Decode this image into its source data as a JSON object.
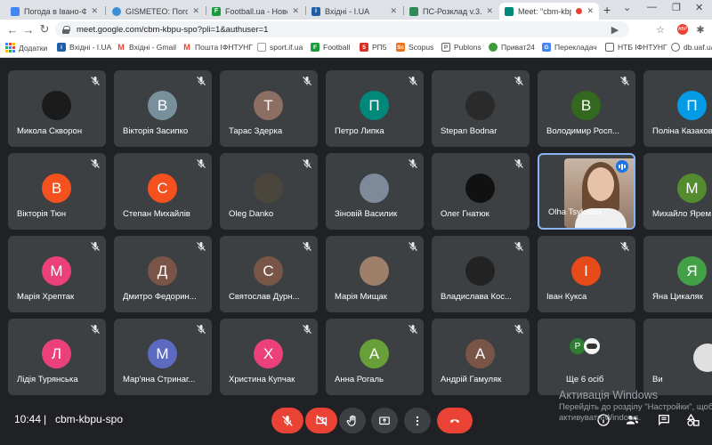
{
  "browser": {
    "tabs": [
      {
        "title": "Погода в Івано-Франк",
        "favicon": "weather",
        "color": "#4285f4"
      },
      {
        "title": "GISMETEO: Погода в",
        "favicon": "gismeteo",
        "color": "#3b8fd6"
      },
      {
        "title": "Football.ua - Новост",
        "favicon": "football",
        "color": "#1a9c3e"
      },
      {
        "title": "Вхідні - I.UA",
        "favicon": "iua",
        "color": "#1f5fa8"
      },
      {
        "title": "ПС-Розклад v.3.8.2",
        "favicon": "schedule",
        "color": "#2e8b57"
      },
      {
        "title": "Meet: \"cbm-kbpu",
        "favicon": "meet",
        "color": "#00897b"
      }
    ],
    "url": "meet.google.com/cbm-kbpu-spo?pli=1&authuser=1",
    "bookmarks": [
      {
        "label": "Додатки",
        "icon": "apps",
        "color": "#5f6368"
      },
      {
        "label": "Вхідні - I.UA",
        "icon": "iua",
        "color": "#1f5fa8"
      },
      {
        "label": "Вхідні - Gmail",
        "icon": "gmail",
        "color": "#ea4335"
      },
      {
        "label": "Пошта ІФНТУНГ",
        "icon": "gmail",
        "color": "#ea4335"
      },
      {
        "label": "sport.if.ua",
        "icon": "page",
        "color": "#9aa0a6"
      },
      {
        "label": "Football",
        "icon": "football",
        "color": "#1a9c3e"
      },
      {
        "label": "РП5",
        "icon": "rp5",
        "color": "#d93025"
      },
      {
        "label": "Scopus",
        "icon": "scopus",
        "color": "#e9711c"
      },
      {
        "label": "Publons",
        "icon": "publons",
        "color": "#5f6368"
      },
      {
        "label": "Приват24",
        "icon": "privat",
        "color": "#3c9b3c"
      },
      {
        "label": "Перекладач",
        "icon": "translate",
        "color": "#4285f4"
      },
      {
        "label": "НТБ ІФНТУНГ",
        "icon": "library",
        "color": "#5f6368"
      },
      {
        "label": "db.uaf.ua",
        "icon": "globe",
        "color": "#5f6368"
      }
    ]
  },
  "participants": [
    {
      "name": "Микола Скворон",
      "initial": "",
      "color": "#1b1b1b",
      "photo": true
    },
    {
      "name": "Вікторія Засипко",
      "initial": "В",
      "color": "#78909c"
    },
    {
      "name": "Тарас Здерка",
      "initial": "Т",
      "color": "#8d6e63"
    },
    {
      "name": "Петро Липка",
      "initial": "П",
      "color": "#00897b"
    },
    {
      "name": "Stepan Bodnar",
      "initial": "",
      "color": "#2a2a2a",
      "photo": true
    },
    {
      "name": "Володимир Росп...",
      "initial": "В",
      "color": "#33691e"
    },
    {
      "name": "Поліна Казакова",
      "initial": "П",
      "color": "#039be5"
    },
    {
      "name": "Вікторія Тюн",
      "initial": "В",
      "color": "#f4511e"
    },
    {
      "name": "Степан Михайлів",
      "initial": "С",
      "color": "#f4511e"
    },
    {
      "name": "Oleg Danko",
      "initial": "",
      "color": "#4a463e",
      "photo": true
    },
    {
      "name": "Зіновій Василик",
      "initial": "",
      "color": "#7c8a99",
      "photo": true
    },
    {
      "name": "Олег Гнатюк",
      "initial": "",
      "color": "#111111",
      "photo": true
    },
    {
      "name": "Olha Tsykaliak",
      "initial": "",
      "color": "#b39a87",
      "video": true
    },
    {
      "name": "Михайло Ярем",
      "initial": "М",
      "color": "#558b2f"
    },
    {
      "name": "Марія Хрептак",
      "initial": "М",
      "color": "#ec407a"
    },
    {
      "name": "Дмитро Федорин...",
      "initial": "Д",
      "color": "#795548"
    },
    {
      "name": "Святослав Дурн...",
      "initial": "С",
      "color": "#795548"
    },
    {
      "name": "Марія Мищак",
      "initial": "",
      "color": "#9e7f6a",
      "photo": true
    },
    {
      "name": "Владислава Кос...",
      "initial": "",
      "color": "#222222",
      "photo": true
    },
    {
      "name": "Іван Кукса",
      "initial": "І",
      "color": "#e64a19"
    },
    {
      "name": "Яна Цикаляк",
      "initial": "Я",
      "color": "#43a047"
    },
    {
      "name": "Лідія Турянська",
      "initial": "Л",
      "color": "#ec407a"
    },
    {
      "name": "Мар'яна Стринаг...",
      "initial": "М",
      "color": "#5c6bc0"
    },
    {
      "name": "Христина Купчак",
      "initial": "Х",
      "color": "#ec407a"
    },
    {
      "name": "Анна Рогаль",
      "initial": "А",
      "color": "#689f38"
    },
    {
      "name": "Андрій Гамуляк",
      "initial": "А",
      "color": "#795548"
    },
    {
      "name": "Ще 6 осіб",
      "initial": "P",
      "color": "#2e7d32",
      "overflow": true
    },
    {
      "name": "Ви",
      "initial": "",
      "color": "#e0e0e0",
      "photo": true,
      "self": true
    }
  ],
  "bottom": {
    "time": "10:44",
    "separator": "|",
    "meeting_code": "cbm-kbpu-spo"
  },
  "windows_watermark": {
    "line1": "Активація Windows",
    "line2": "Перейдіть до розділу \"Настройки\", щоб",
    "line3": "активувати Windows."
  }
}
